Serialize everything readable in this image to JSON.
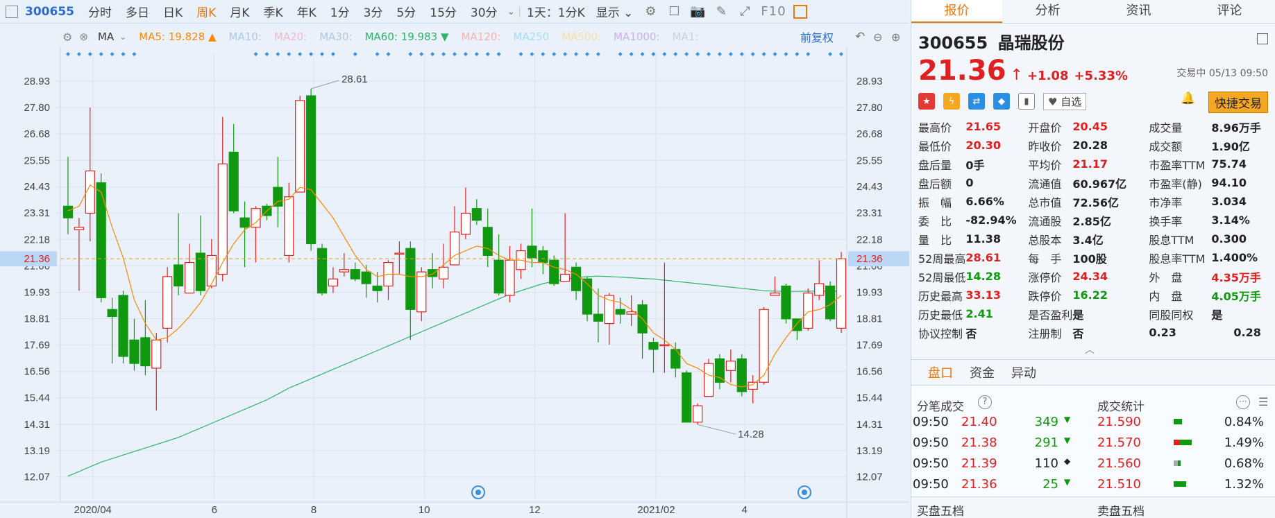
{
  "toolbar": {
    "code": "300655",
    "tabs": [
      "分时",
      "多日",
      "日K",
      "周K",
      "月K",
      "季K",
      "年K",
      "1分",
      "3分",
      "5分",
      "15分",
      "30分"
    ],
    "active_tab": "周K",
    "interval": "1天：1分K",
    "display": "显示",
    "f10": "F10"
  },
  "ma_bar": {
    "label": "MA",
    "items": [
      {
        "text": "MA5: 19.828 ▲",
        "color": "#ff8800"
      },
      {
        "text": "MA10:",
        "color": "#a8c8f0"
      },
      {
        "text": "MA20:",
        "color": "#f4b6cc"
      },
      {
        "text": "MA30:",
        "color": "#b0c8e0"
      },
      {
        "text": "MA60: 19.983 ▼",
        "color": "#2db36b"
      },
      {
        "text": "MA120:",
        "color": "#f8b0b0"
      },
      {
        "text": "MA250",
        "color": "#a0e0f0"
      },
      {
        "text": "MA500:",
        "color": "#f5e0a0"
      },
      {
        "text": "MA1000:",
        "color": "#c8b0f0"
      },
      {
        "text": "MA1:",
        "color": "#c8d0e0"
      }
    ],
    "adj": "前复权"
  },
  "chart_data": {
    "type": "candlestick",
    "y_ticks": [
      "28.93",
      "27.80",
      "26.68",
      "25.55",
      "24.43",
      "23.31",
      "22.18",
      "21.06",
      "19.93",
      "18.81",
      "17.69",
      "16.56",
      "15.44",
      "14.31",
      "13.19",
      "12.07"
    ],
    "ylim": [
      11.5,
      29.9
    ],
    "x_labels": [
      "2020/04",
      "6",
      "8",
      "10",
      "12",
      "2021/02",
      "4"
    ],
    "current_price": "21.36",
    "max_label": "28.61",
    "min_label": "14.28",
    "candles": [
      [
        23.6,
        23.1,
        25.7,
        22.4
      ],
      [
        22.6,
        22.7,
        23.1,
        20.0
      ],
      [
        23.3,
        25.1,
        27.8,
        22.1
      ],
      [
        24.6,
        19.7,
        25.0,
        19.5
      ],
      [
        19.2,
        18.9,
        19.7,
        16.9
      ],
      [
        19.8,
        17.2,
        20.0,
        16.9
      ],
      [
        17.9,
        16.9,
        18.8,
        16.6
      ],
      [
        18.0,
        16.8,
        19.6,
        16.4
      ],
      [
        16.7,
        17.9,
        18.2,
        14.9
      ],
      [
        18.4,
        20.6,
        21.0,
        17.8
      ],
      [
        21.1,
        20.2,
        23.3,
        19.8
      ],
      [
        19.9,
        21.2,
        22.0,
        20.2
      ],
      [
        21.6,
        20.0,
        23.2,
        19.8
      ],
      [
        20.2,
        21.5,
        22.2,
        20.1
      ],
      [
        20.7,
        25.4,
        27.4,
        20.4
      ],
      [
        25.9,
        23.4,
        27.1,
        23.3
      ],
      [
        23.1,
        22.7,
        23.8,
        21.0
      ],
      [
        22.7,
        23.5,
        23.6,
        21.2
      ],
      [
        23.6,
        23.2,
        23.7,
        23.0
      ],
      [
        24.4,
        23.6,
        25.7,
        22.7
      ],
      [
        21.5,
        24.0,
        24.6,
        21.2
      ],
      [
        24.2,
        28.1,
        28.3,
        24.2
      ],
      [
        28.3,
        22.0,
        28.6,
        21.7
      ],
      [
        21.8,
        19.9,
        22.0,
        19.8
      ],
      [
        20.2,
        20.5,
        21.0,
        19.9
      ],
      [
        20.8,
        20.9,
        21.6,
        20.6
      ],
      [
        20.9,
        20.5,
        21.2,
        20.4
      ],
      [
        20.8,
        20.3,
        21.1,
        19.7
      ],
      [
        20.2,
        20.0,
        20.8,
        19.5
      ],
      [
        20.2,
        21.2,
        21.3,
        19.6
      ],
      [
        21.6,
        21.6,
        22.1,
        20.7
      ],
      [
        21.8,
        19.2,
        22.1,
        17.9
      ],
      [
        19.1,
        20.8,
        21.0,
        18.7
      ],
      [
        20.9,
        20.6,
        21.6,
        20.1
      ],
      [
        20.5,
        21.0,
        22.0,
        20.1
      ],
      [
        21.1,
        22.5,
        23.6,
        21.1
      ],
      [
        22.4,
        23.3,
        24.4,
        22.2
      ],
      [
        23.5,
        23.0,
        23.9,
        22.8
      ],
      [
        22.7,
        21.5,
        23.5,
        21.0
      ],
      [
        21.3,
        19.9,
        22.4,
        19.8
      ],
      [
        19.8,
        21.3,
        21.9,
        19.5
      ],
      [
        20.9,
        21.7,
        22.0,
        20.5
      ],
      [
        21.9,
        21.4,
        23.5,
        21.0
      ],
      [
        21.7,
        21.2,
        21.9,
        20.7
      ],
      [
        21.3,
        20.3,
        21.5,
        20.2
      ],
      [
        20.4,
        20.7,
        23.3,
        20.4
      ],
      [
        21.0,
        20.0,
        21.2,
        19.6
      ],
      [
        20.5,
        19.0,
        20.6,
        18.7
      ],
      [
        19.0,
        18.7,
        20.1,
        17.8
      ],
      [
        18.6,
        19.8,
        19.9,
        17.7
      ],
      [
        19.2,
        19.0,
        19.7,
        18.6
      ],
      [
        19.0,
        19.1,
        19.8,
        18.5
      ],
      [
        19.4,
        18.2,
        19.6,
        17.1
      ],
      [
        17.8,
        17.5,
        18.0,
        16.5
      ],
      [
        17.7,
        17.7,
        21.2,
        16.5
      ],
      [
        17.5,
        16.7,
        17.8,
        16.3
      ],
      [
        16.5,
        14.4,
        16.6,
        14.4
      ],
      [
        14.4,
        15.1,
        15.2,
        14.3
      ],
      [
        15.5,
        16.9,
        17.1,
        15.5
      ],
      [
        17.1,
        16.1,
        17.3,
        15.8
      ],
      [
        16.6,
        17.0,
        17.5,
        16.1
      ],
      [
        17.1,
        15.7,
        17.3,
        15.5
      ],
      [
        15.8,
        16.1,
        16.4,
        15.2
      ],
      [
        16.1,
        19.2,
        19.3,
        16.0
      ],
      [
        19.8,
        19.9,
        20.6,
        19.8
      ],
      [
        20.2,
        18.8,
        20.3,
        18.6
      ],
      [
        18.8,
        18.3,
        18.8,
        17.9
      ],
      [
        18.4,
        19.9,
        20.1,
        18.3
      ],
      [
        19.8,
        20.3,
        21.3,
        19.6
      ],
      [
        20.2,
        18.8,
        20.4,
        18.7
      ],
      [
        18.4,
        21.36,
        21.65,
        18.2
      ]
    ],
    "ma_short": [
      23.4,
      23.6,
      24.5,
      24.2,
      22.7,
      21.4,
      19.6,
      18.6,
      17.9,
      18.0,
      18.4,
      18.9,
      19.5,
      20.3,
      21.2,
      22.0,
      22.6,
      22.9,
      23.4,
      23.8,
      23.9,
      24.4,
      24.3,
      23.7,
      23.1,
      22.3,
      21.5,
      20.9,
      20.6,
      20.7,
      20.7,
      20.6,
      20.6,
      20.7,
      21.1,
      21.5,
      21.7,
      21.9,
      21.8,
      21.5,
      21.3,
      21.3,
      21.2,
      21.2,
      21.0,
      20.9,
      20.7,
      20.3,
      19.8,
      19.6,
      19.5,
      19.2,
      18.8,
      18.2,
      17.9,
      17.5,
      16.9,
      16.7,
      16.4,
      16.3,
      16.0,
      15.9,
      16.0,
      16.4,
      17.3,
      18.0,
      18.6,
      19.1,
      19.2,
      19.4,
      19.8
    ],
    "ma_long": [
      12.1,
      12.3,
      12.5,
      12.7,
      12.85,
      13.0,
      13.15,
      13.3,
      13.45,
      13.6,
      13.75,
      13.95,
      14.15,
      14.35,
      14.55,
      14.75,
      14.95,
      15.15,
      15.35,
      15.6,
      15.85,
      16.05,
      16.25,
      16.45,
      16.65,
      16.85,
      17.05,
      17.25,
      17.45,
      17.65,
      17.85,
      18.05,
      18.25,
      18.45,
      18.65,
      18.85,
      19.05,
      19.25,
      19.45,
      19.65,
      19.85,
      20.0,
      20.15,
      20.3,
      20.4,
      20.5,
      20.55,
      20.6,
      20.62,
      20.6,
      20.58,
      20.55,
      20.52,
      20.5,
      20.45,
      20.4,
      20.35,
      20.3,
      20.25,
      20.2,
      20.15,
      20.1,
      20.05,
      20.0,
      19.98,
      19.97,
      19.97,
      19.98,
      19.98,
      19.98,
      19.98
    ]
  },
  "stock": {
    "code": "300655",
    "name": "晶瑞股份",
    "price": "21.36",
    "arrow": "↑",
    "change": "+1.08",
    "pct": "+5.33%",
    "status": "交易中 05/13 09:50",
    "watch": "自选",
    "quick_trade": "快捷交易"
  },
  "quote_rows": [
    [
      {
        "l": "最高价",
        "v": "21.65",
        "c": "red"
      },
      {
        "l": "开盘价",
        "v": "20.45",
        "c": "red"
      },
      {
        "l": "成交量",
        "v": "8.96万手",
        "c": "blk"
      }
    ],
    [
      {
        "l": "最低价",
        "v": "20.30",
        "c": "red"
      },
      {
        "l": "昨收价",
        "v": "20.28",
        "c": "blk"
      },
      {
        "l": "成交额",
        "v": "1.90亿",
        "c": "blk"
      }
    ],
    [
      {
        "l": "盘后量",
        "v": "0手",
        "c": "blk"
      },
      {
        "l": "平均价",
        "v": "21.17",
        "c": "red"
      },
      {
        "l": "市盈率TTM",
        "v": "75.74",
        "c": "blk"
      }
    ],
    [
      {
        "l": "盘后额",
        "v": "0",
        "c": "blk"
      },
      {
        "l": "流通值",
        "v": "60.967亿",
        "c": "blk"
      },
      {
        "l": "市盈率(静)",
        "v": "94.10",
        "c": "blk"
      }
    ],
    [
      {
        "l": "振　幅",
        "v": "6.66%",
        "c": "blk"
      },
      {
        "l": "总市值",
        "v": "72.56亿",
        "c": "blk"
      },
      {
        "l": "市净率",
        "v": "3.034",
        "c": "blk"
      }
    ],
    [
      {
        "l": "委　比",
        "v": "-82.94%",
        "c": "blk"
      },
      {
        "l": "流通股",
        "v": "2.85亿",
        "c": "blk"
      },
      {
        "l": "换手率",
        "v": "3.14%",
        "c": "blk"
      }
    ],
    [
      {
        "l": "量　比",
        "v": "11.38",
        "c": "blk"
      },
      {
        "l": "总股本",
        "v": "3.4亿",
        "c": "blk"
      },
      {
        "l": "股息TTM",
        "v": "0.300",
        "c": "blk"
      }
    ],
    [
      {
        "l": "52周最高",
        "v": "28.61",
        "c": "red"
      },
      {
        "l": "每　手",
        "v": "100股",
        "c": "blk"
      },
      {
        "l": "股息率TTM",
        "v": "1.400%",
        "c": "blk"
      }
    ],
    [
      {
        "l": "52周最低",
        "v": "14.28",
        "c": "green"
      },
      {
        "l": "涨停价",
        "v": "24.34",
        "c": "red"
      },
      {
        "l": "外　盘",
        "v": "4.35万手",
        "c": "red"
      }
    ],
    [
      {
        "l": "历史最高",
        "v": "33.13",
        "c": "red"
      },
      {
        "l": "跌停价",
        "v": "16.22",
        "c": "green"
      },
      {
        "l": "内　盘",
        "v": "4.05万手",
        "c": "green"
      }
    ],
    [
      {
        "l": "历史最低",
        "v": "2.41",
        "c": "green"
      },
      {
        "l": "是否盈利",
        "v": "是",
        "c": "blk"
      },
      {
        "l": "同股同权",
        "v": "是",
        "c": "blk"
      }
    ],
    [
      {
        "l": "协议控制",
        "v": "否",
        "c": "blk"
      },
      {
        "l": "注册制",
        "v": "否",
        "c": "blk"
      },
      {
        "l": "0.23",
        "v": "0.28",
        "c": "blk"
      }
    ]
  ],
  "right_tabs": [
    "报价",
    "分析",
    "资讯",
    "评论"
  ],
  "panel_tabs": [
    "盘口",
    "资金",
    "异动"
  ],
  "trades_title": "分笔成交",
  "stats_title": "成交统计",
  "trades": [
    {
      "t": "09:50",
      "p": "21.40",
      "v": "349",
      "d": "▼",
      "vc": "green"
    },
    {
      "t": "09:50",
      "p": "21.38",
      "v": "291",
      "d": "▼",
      "vc": "green"
    },
    {
      "t": "09:50",
      "p": "21.39",
      "v": "110",
      "d": "◆",
      "vc": "blk"
    },
    {
      "t": "09:50",
      "p": "21.36",
      "v": "25",
      "d": "▼",
      "vc": "green"
    }
  ],
  "stats": [
    {
      "p": "21.590",
      "pct": "0.84%"
    },
    {
      "p": "21.570",
      "pct": "1.49%"
    },
    {
      "p": "21.560",
      "pct": "0.68%"
    },
    {
      "p": "21.510",
      "pct": "1.32%"
    }
  ],
  "buy5": "买盘五档",
  "sell5": "卖盘五档"
}
